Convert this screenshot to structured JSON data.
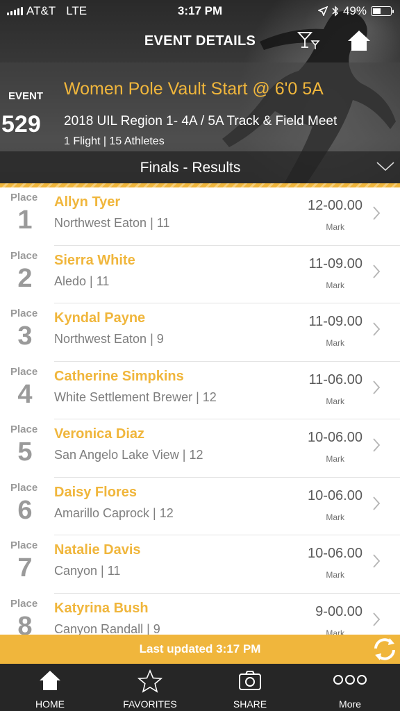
{
  "status_bar": {
    "carrier": "AT&T",
    "network": "LTE",
    "time": "3:17 PM",
    "battery": "49%",
    "battery_level": 0.49
  },
  "nav": {
    "title": "EVENT DETAILS",
    "filter_icon": "filter-cocktail-icon",
    "home_icon": "home-icon"
  },
  "event": {
    "label": "EVENT",
    "number": "529",
    "title": "Women Pole Vault Start @ 6'0 5A",
    "meet": "2018 UIL Region 1- 4A / 5A Track & Field Meet",
    "subtitle": "1 Flight | 15 Athletes"
  },
  "results": {
    "title": "Finals - Results"
  },
  "place_label": "Place",
  "mark_label": "Mark",
  "athletes": [
    {
      "place": "1",
      "name": "Allyn Tyer",
      "school": "Northwest Eaton | 11",
      "mark": "12-00.00"
    },
    {
      "place": "2",
      "name": "Sierra White",
      "school": "Aledo | 11",
      "mark": "11-09.00"
    },
    {
      "place": "3",
      "name": "Kyndal Payne",
      "school": "Northwest Eaton | 9",
      "mark": "11-09.00"
    },
    {
      "place": "4",
      "name": "Catherine Simpkins",
      "school": "White Settlement Brewer | 12",
      "mark": "11-06.00"
    },
    {
      "place": "5",
      "name": "Veronica Diaz",
      "school": "San Angelo Lake View | 12",
      "mark": "10-06.00"
    },
    {
      "place": "6",
      "name": "Daisy Flores",
      "school": "Amarillo Caprock | 12",
      "mark": "10-06.00"
    },
    {
      "place": "7",
      "name": "Natalie Davis",
      "school": "Canyon | 11",
      "mark": "10-06.00"
    },
    {
      "place": "8",
      "name": "Katyrina Bush",
      "school": "Canyon Randall | 9",
      "mark": "9-00.00"
    }
  ],
  "updated": {
    "text": "Last updated 3:17 PM"
  },
  "tabs": [
    {
      "label": "HOME",
      "icon": "home-icon"
    },
    {
      "label": "FAVORITES",
      "icon": "star-icon"
    },
    {
      "label": "SHARE",
      "icon": "camera-icon"
    },
    {
      "label": "More",
      "icon": "more-dots-icon"
    }
  ],
  "colors": {
    "accent": "#f0b63c",
    "tabbar": "#262626",
    "muted": "#9a9a9a"
  }
}
